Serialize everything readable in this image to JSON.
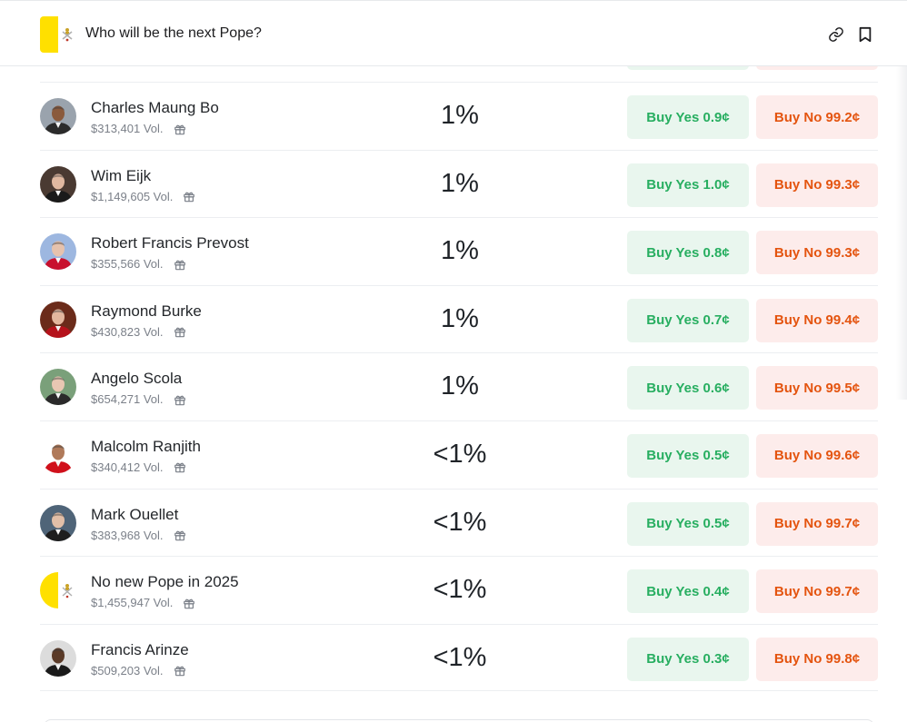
{
  "header": {
    "title": "Who will be the next Pope?",
    "flag_colors": [
      "#ffe000",
      "#ffffff"
    ],
    "icons": [
      "link-icon",
      "bookmark-icon"
    ]
  },
  "colors": {
    "yes_bg": "#e9f6ee",
    "yes_text": "#27ae60",
    "no_bg": "#fdeceb",
    "no_text": "#e4540f"
  },
  "candidates": [
    {
      "name": "Charles Maung Bo",
      "volume": "$313,401 Vol.",
      "chance": "1%",
      "yes": "Buy Yes 0.9¢",
      "no": "Buy No 99.2¢",
      "avatar": "portrait",
      "skin": "#8a5a3c",
      "robe": "#2b2b2b",
      "bg": "#9aa3ad"
    },
    {
      "name": "Wim Eijk",
      "volume": "$1,149,605 Vol.",
      "chance": "1%",
      "yes": "Buy Yes 1.0¢",
      "no": "Buy No 99.3¢",
      "avatar": "portrait",
      "skin": "#e0b8a0",
      "robe": "#1a1a1a",
      "bg": "#4a3a32"
    },
    {
      "name": "Robert Francis Prevost",
      "volume": "$355,566 Vol.",
      "chance": "1%",
      "yes": "Buy Yes 0.8¢",
      "no": "Buy No 99.3¢",
      "avatar": "portrait",
      "skin": "#e6c2ad",
      "robe": "#c8102e",
      "bg": "#9db7e0"
    },
    {
      "name": "Raymond Burke",
      "volume": "$430,823 Vol.",
      "chance": "1%",
      "yes": "Buy Yes 0.7¢",
      "no": "Buy No 99.4¢",
      "avatar": "portrait",
      "skin": "#e3b79e",
      "robe": "#b5121b",
      "bg": "#6b2b1a"
    },
    {
      "name": "Angelo Scola",
      "volume": "$654,271 Vol.",
      "chance": "1%",
      "yes": "Buy Yes 0.6¢",
      "no": "Buy No 99.5¢",
      "avatar": "portrait",
      "skin": "#e8c7b2",
      "robe": "#2a2a2a",
      "bg": "#7aa07a"
    },
    {
      "name": "Malcolm Ranjith",
      "volume": "$340,412 Vol.",
      "chance": "<1%",
      "yes": "Buy Yes 0.5¢",
      "no": "Buy No 99.6¢",
      "avatar": "portrait",
      "skin": "#b07a5a",
      "robe": "#d0101b",
      "bg": "#ffffff"
    },
    {
      "name": "Mark Ouellet",
      "volume": "$383,968 Vol.",
      "chance": "<1%",
      "yes": "Buy Yes 0.5¢",
      "no": "Buy No 99.7¢",
      "avatar": "portrait",
      "skin": "#e2bfa8",
      "robe": "#1e1e1e",
      "bg": "#4f6478"
    },
    {
      "name": "No new Pope in 2025",
      "volume": "$1,455,947 Vol.",
      "chance": "<1%",
      "yes": "Buy Yes 0.4¢",
      "no": "Buy No 99.7¢",
      "avatar": "flag",
      "skin": "#ffe000",
      "robe": "#ffffff",
      "bg": "#ffffff"
    },
    {
      "name": "Francis Arinze",
      "volume": "$509,203 Vol.",
      "chance": "<1%",
      "yes": "Buy Yes 0.3¢",
      "no": "Buy No 99.8¢",
      "avatar": "portrait",
      "skin": "#5a3a28",
      "robe": "#1a1a1a",
      "bg": "#dcdcdc"
    }
  ]
}
